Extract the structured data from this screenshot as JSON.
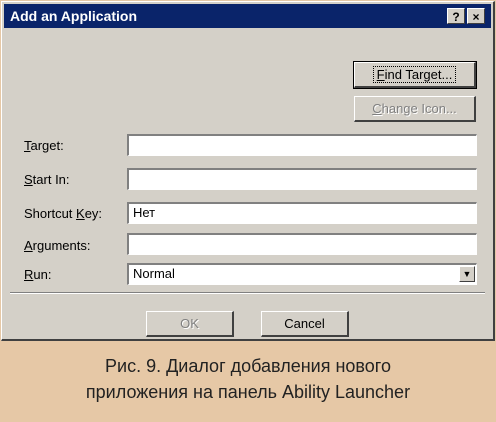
{
  "dialog": {
    "title": "Add an Application",
    "help_glyph": "?",
    "close_glyph": "×"
  },
  "buttons": {
    "find_target": {
      "accel": "F",
      "rest": "ind Target..."
    },
    "change_icon": {
      "accel": "C",
      "rest": "hange Icon..."
    },
    "ok": "OK",
    "cancel": "Cancel"
  },
  "fields": {
    "target": {
      "accel": "T",
      "rest": "arget:",
      "value": ""
    },
    "start_in": {
      "accel": "S",
      "rest": "tart In:",
      "value": ""
    },
    "shortcut_key": {
      "prefix": "Shortcut ",
      "accel": "K",
      "rest": "ey:",
      "value": "Нет"
    },
    "arguments": {
      "accel": "A",
      "rest": "rguments:",
      "value": ""
    },
    "run": {
      "accel": "R",
      "rest": "un:",
      "value": "Normal"
    }
  },
  "caption": {
    "line1": "Рис. 9. Диалог добавления нового",
    "line2": "приложения на панель Ability Launcher"
  }
}
